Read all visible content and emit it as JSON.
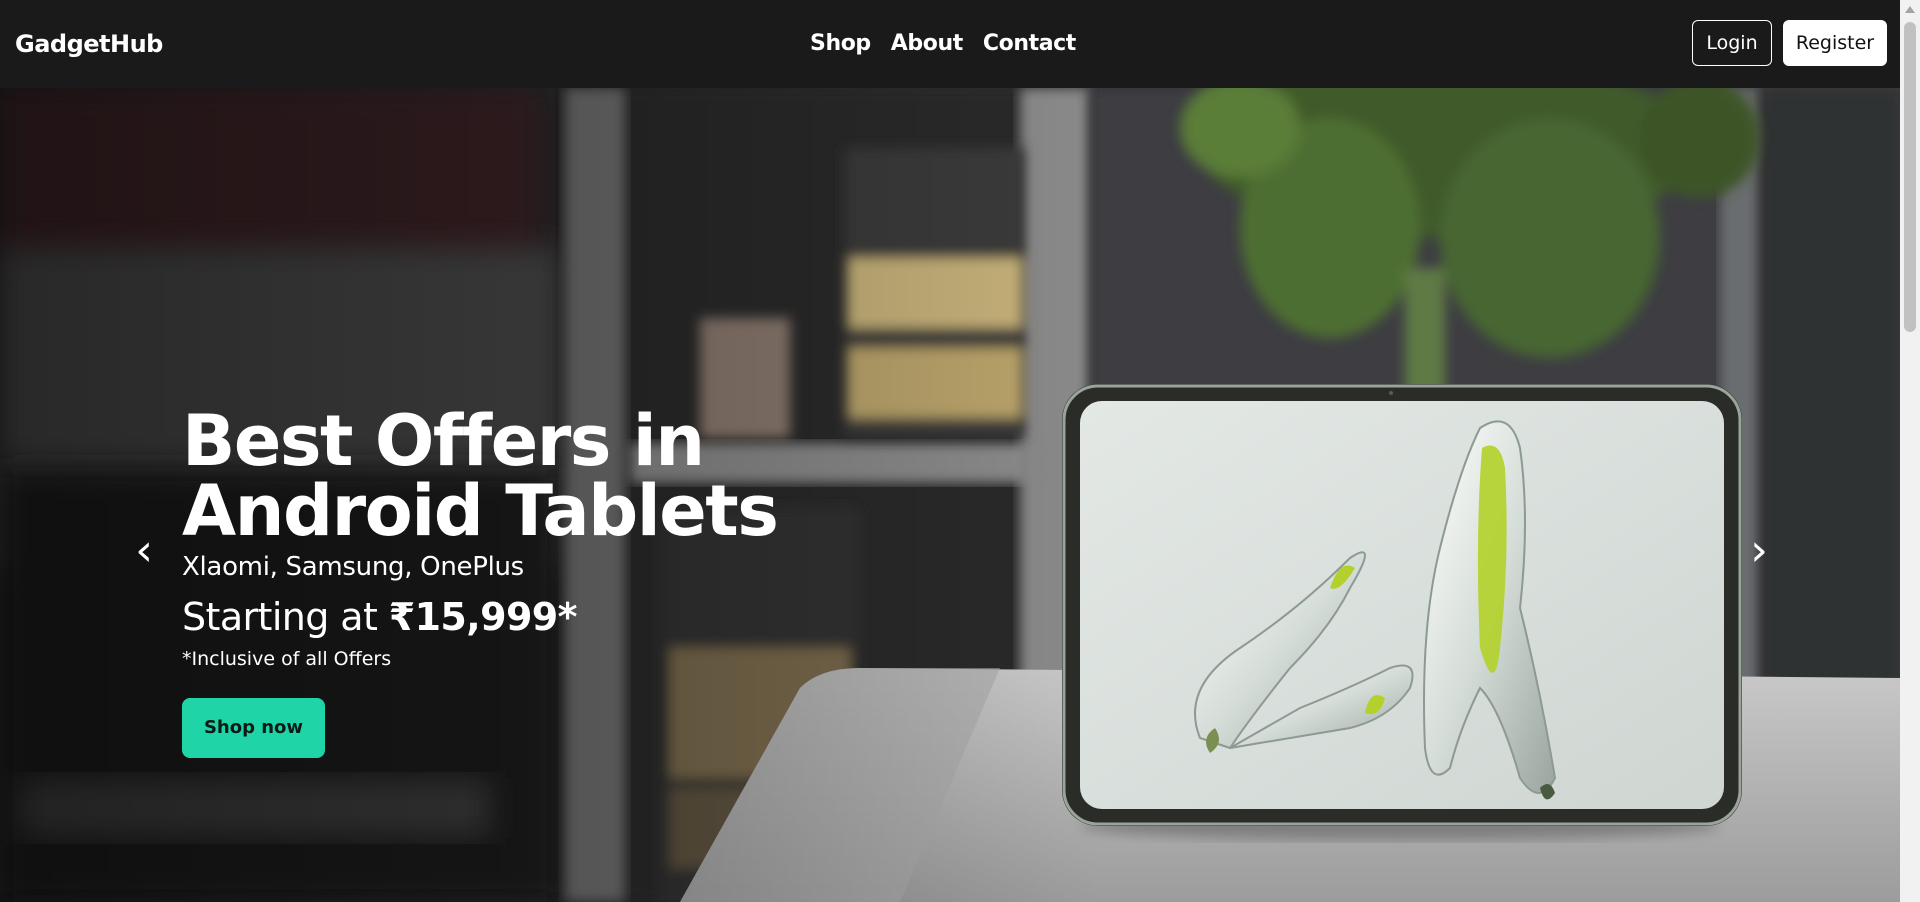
{
  "navbar": {
    "brand": "GadgetHub",
    "links": [
      "Shop",
      "About",
      "Contact"
    ],
    "login_label": "Login",
    "register_label": "Register"
  },
  "hero": {
    "title": "Best Offers in Android Tablets",
    "brands": "Xlaomi, Samsung, OnePlus",
    "price_prefix": "Starting at ",
    "price_amount": "₹15,999*",
    "note": "*Inclusive of all Offers",
    "cta_label": "Shop now",
    "prev_icon": "‹",
    "next_icon": "›"
  },
  "colors": {
    "navbar_bg": "#1a1a1a",
    "cta_bg": "#1fd4a6",
    "tablet_screen": "#dfe5e2",
    "accent_lime": "#b3d12a"
  }
}
